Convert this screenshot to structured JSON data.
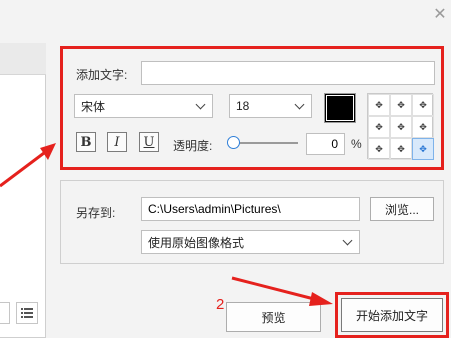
{
  "window": {
    "close_icon": "close-icon"
  },
  "text_group": {
    "add_text_label": "添加文字:",
    "add_text_value": "",
    "font": "宋体",
    "size": "18",
    "color": "#000000",
    "bold": "B",
    "italic": "I",
    "underline": "U",
    "opacity_label": "透明度:",
    "opacity_value": "0",
    "opacity_unit": "%",
    "position_grid": [
      "top-left",
      "top-center",
      "top-right",
      "middle-left",
      "center",
      "middle-right",
      "bottom-left",
      "bottom-center",
      "bottom-right"
    ],
    "selected_position": "bottom-right"
  },
  "save_group": {
    "save_to_label": "另存到:",
    "path_value": "C:\\Users\\admin\\Pictures\\",
    "browse_label": "浏览...",
    "format_value": "使用原始图像格式"
  },
  "footer": {
    "annotation_number": "2",
    "preview_label": "预览",
    "start_label": "开始添加文字"
  },
  "colors": {
    "accent_red": "#e5211d",
    "selected_blue": "#2f7fd8"
  }
}
